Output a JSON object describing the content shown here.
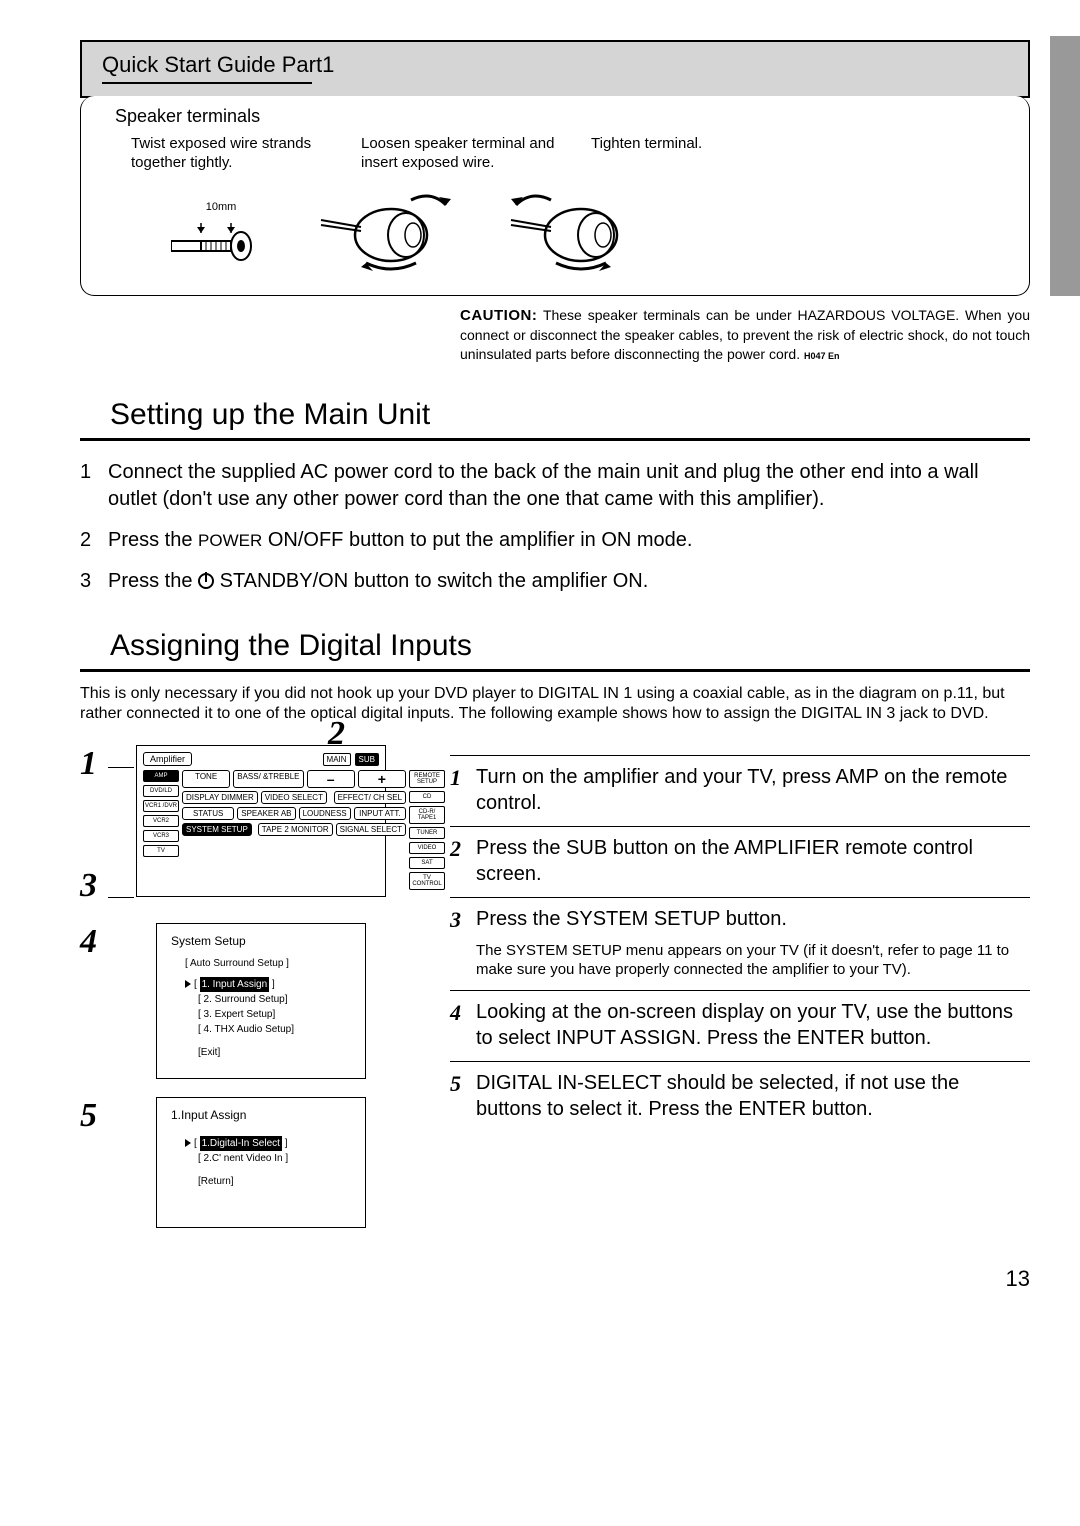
{
  "header": {
    "title": "Quick Start Guide   Part1"
  },
  "speaker": {
    "title": "Speaker terminals",
    "col1": "Twist exposed wire strands together tightly.",
    "col2": "Loosen speaker terminal and insert exposed wire.",
    "col3": "Tighten terminal.",
    "measure": "10mm"
  },
  "caution": {
    "label": "CAUTION:",
    "text": "These speaker terminals can be under HAZARDOUS VOLTAGE. When you connect or disconnect the speaker cables, to prevent the risk of electric shock, do not touch uninsulated parts before disconnecting the power cord.",
    "code": "H047 En"
  },
  "section1": {
    "title": "Setting up the Main Unit",
    "steps": [
      {
        "n": "1",
        "t": "Connect the supplied AC power cord to the back of the main unit and plug the other end into a wall outlet (don't use any other power cord than the one that came with this amplifier)."
      },
      {
        "n": "2",
        "t_a": "Press the ",
        "t_b": "POWER",
        "t_c": " ON/OFF button to put the amplifier in ON mode."
      },
      {
        "n": "3",
        "t_a": "Press the ",
        "t_b": " STANDBY/ON button to switch the amplifier ON."
      }
    ]
  },
  "section2": {
    "title": "Assigning the Digital Inputs",
    "intro": "This is only necessary if you did not hook up your DVD player to DIGITAL IN 1 using a coaxial cable, as in the diagram on p.11, but rather connected it to one of the optical digital inputs. The following example shows how to assign the DIGITAL IN 3 jack to DVD."
  },
  "callouts": {
    "c1": "1",
    "c2": "2",
    "c3": "3",
    "c4": "4",
    "c5": "5"
  },
  "remote": {
    "label": "Amplifier",
    "main": "MAIN",
    "sub": "SUB",
    "side_left": [
      "AMP",
      "DVD/LD",
      "VCR1 /DVR",
      "VCR2",
      "VCR3",
      "TV"
    ],
    "side_right": [
      "REMOTE SETUP",
      "CD",
      "CD-R/ TAPE1",
      "TUNER",
      "VIDEO",
      "SAT",
      "TV CONTROL"
    ],
    "row2": [
      "TONE",
      "BASS/ &TREBLE",
      "–",
      "+"
    ],
    "row3": [
      "DISPLAY DIMMER",
      "VIDEO SELECT",
      "",
      "EFFECT/ CH SEL"
    ],
    "row4": [
      "STATUS",
      "SPEAKER AB",
      "LOUDNESS",
      "INPUT ATT."
    ],
    "row5": [
      "SYSTEM SETUP",
      "",
      "TAPE 2 MONITOR",
      "SIGNAL SELECT"
    ]
  },
  "osd1": {
    "title": "System Setup",
    "auto": "[  Auto Surround Setup   ]",
    "items": [
      "1. Input Assign",
      "[ 2. Surround Setup]",
      "[ 3. Expert Setup]",
      "[ 4. THX Audio Setup]"
    ],
    "exit": "[Exit]"
  },
  "osd2": {
    "title": "1.Input Assign",
    "items": [
      "1.Digital-In Select",
      "[ 2.C' nent Video In ]"
    ],
    "return": "[Return]"
  },
  "rightSteps": [
    {
      "n": "1",
      "t": "Turn on the amplifier and your TV, press AMP on the remote control."
    },
    {
      "n": "2",
      "t": "Press the SUB button on the AMPLIFIER remote control screen."
    },
    {
      "n": "3",
      "t": "Press the SYSTEM SETUP button.",
      "note": "The SYSTEM SETUP menu appears on your TV (if it doesn't, refer to page 11 to make sure you have properly connected the amplifier to your TV)."
    },
    {
      "n": "4",
      "t": "Looking at the on-screen display on your TV, use the          buttons to select INPUT ASSIGN. Press the ENTER button."
    },
    {
      "n": "5",
      "t": "DIGITAL IN-SELECT should be selected, if not use the           buttons to select it. Press the ENTER button."
    }
  ],
  "pageNumber": "13"
}
